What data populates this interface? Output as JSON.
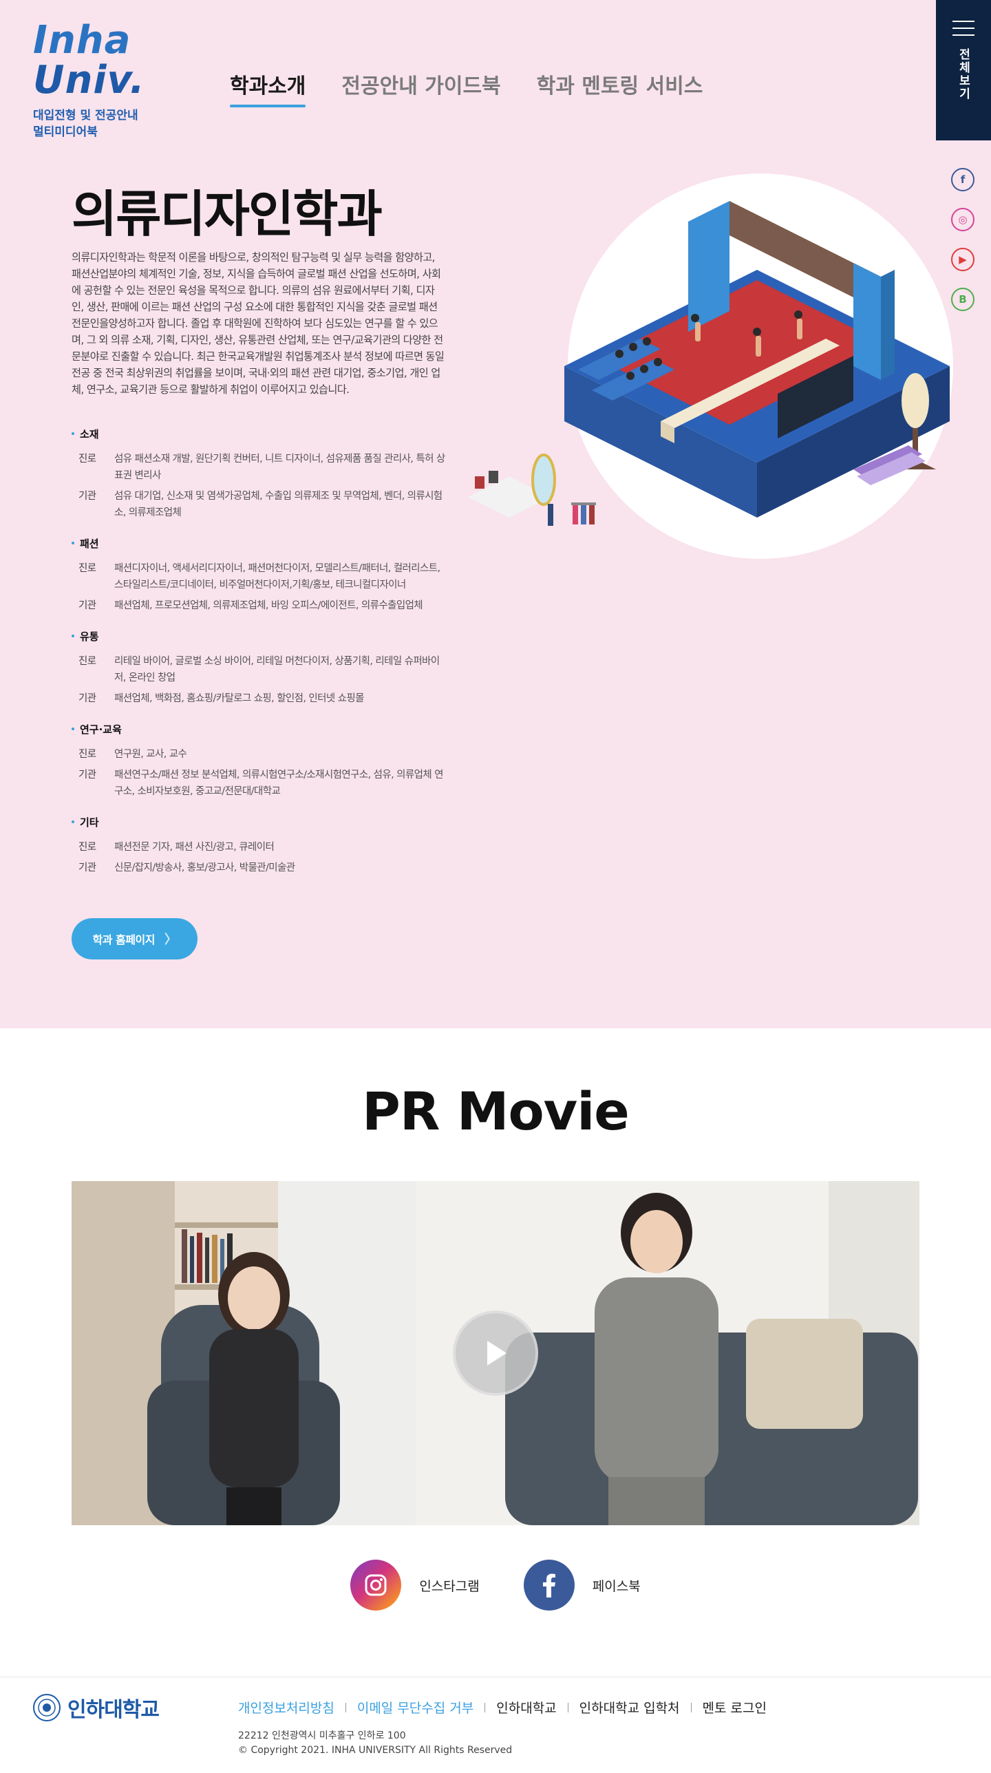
{
  "logo": {
    "line1": "Inha",
    "line2": "Univ.",
    "sub1": "대입전형 및 전공안내",
    "sub2": "멀티미디어북"
  },
  "nav": {
    "items": [
      {
        "label": "학과소개",
        "active": true
      },
      {
        "label": "전공안내 가이드북",
        "active": false
      },
      {
        "label": "학과 멘토링 서비스",
        "active": false
      }
    ]
  },
  "menu": {
    "label": "전체보기"
  },
  "sns_side": {
    "facebook": "f",
    "instagram": "◎",
    "youtube": "▶",
    "blog": "B"
  },
  "dept": {
    "title": "의류디자인학과",
    "intro": "의류디자인학과는 학문적 이론을 바탕으로, 창의적인 탐구능력 및 실무 능력을 함양하고, 패션산업분야의 체계적인 기술, 정보, 지식을 습득하여 글로벌 패션 산업을 선도하며, 사회에 공헌할 수 있는 전문인 육성을 목적으로 합니다. 의류의 섬유 원료에서부터 기획, 디자인, 생산, 판매에 이르는 패션 산업의 구성 요소에 대한 통합적인 지식을 갖춘 글로벌 패션 전문인을양성하고자 합니다. 졸업 후 대학원에 진학하여 보다 심도있는 연구를 할 수 있으며, 그 외 의류 소재, 기획, 디자인, 생산, 유통관련 산업체, 또는 연구/교육기관의 다양한 전문분야로 진출할 수 있습니다. 최근 한국교육개발원 취업통계조사 분석 정보에 따르면 동일 전공 중 전국 최상위권의 취업률을 보이며, 국내·외의 패션 관련 대기업, 중소기업, 개인 업체, 연구소, 교육기관 등으로 활발하게 취업이 이루어지고 있습니다."
  },
  "careers": [
    {
      "name": "소재",
      "rows": [
        {
          "k": "진로",
          "v": "섬유 패션소재 개발, 원단기획 컨버터, 니트 디자이너, 섬유제품 품질 관리사, 특허 상표권 변리사"
        },
        {
          "k": "기관",
          "v": "섬유 대기업, 신소재 및 염색가공업체, 수출입 의류제조 및 무역업체, 벤더, 의류시험소, 의류제조업체"
        }
      ]
    },
    {
      "name": "패션",
      "rows": [
        {
          "k": "진로",
          "v": "패션디자이너, 액세서리디자이너, 패션머천다이저, 모델리스트/패터너, 컬러리스트, 스타일리스트/코디네이터, 비주얼머천다이저,기획/홍보, 테크니컬디자이너"
        },
        {
          "k": "기관",
          "v": "패션업체, 프로모션업체, 의류제조업체, 바잉 오피스/에이전트, 의류수출입업체"
        }
      ]
    },
    {
      "name": "유통",
      "rows": [
        {
          "k": "진로",
          "v": "리테일 바이어, 글로벌 소싱 바이어, 리테일 머천다이저, 상품기획, 리테일 슈퍼바이저, 온라인 창업"
        },
        {
          "k": "기관",
          "v": "패션업체, 백화점, 홈쇼핑/카탈로그 쇼핑, 할인점, 인터넷 쇼핑몰"
        }
      ]
    },
    {
      "name": "연구·교육",
      "rows": [
        {
          "k": "진로",
          "v": "연구원, 교사, 교수"
        },
        {
          "k": "기관",
          "v": "패션연구소/패션 정보 분석업체, 의류시험연구소/소재시험연구소, 섬유, 의류업체 연구소, 소비자보호원, 중고교/전문대/대학교"
        }
      ]
    },
    {
      "name": "기타",
      "rows": [
        {
          "k": "진로",
          "v": "패션전문 기자, 패션 사진/광고, 큐레이터"
        },
        {
          "k": "기관",
          "v": "신문/잡지/방송사, 홍보/광고사, 박물관/미술관"
        }
      ]
    }
  ],
  "homepage_button": {
    "label": "학과 홈페이지",
    "chevron": "〉"
  },
  "pr": {
    "title": "PR Movie"
  },
  "social": {
    "instagram": "인스타그램",
    "facebook": "페이스북"
  },
  "footer": {
    "logo_text": "인하대학교",
    "links": [
      {
        "label": "개인정보처리방침",
        "blue": true
      },
      {
        "label": "이메일 무단수집 거부",
        "blue": true
      },
      {
        "label": "인하대학교",
        "blue": false
      },
      {
        "label": "인하대학교 입학처",
        "blue": false
      },
      {
        "label": "멘토 로그인",
        "blue": false
      }
    ],
    "address": "22212 인천광역시 미추홀구 인하로 100",
    "copyright": "© Copyright 2021. INHA UNIVERSITY All Rights Reserved"
  },
  "colors": {
    "hero_bg": "#f9e3ec",
    "accent": "#3aa0e0",
    "navy": "#0d2341",
    "brand_blue": "#1e5aa8"
  }
}
